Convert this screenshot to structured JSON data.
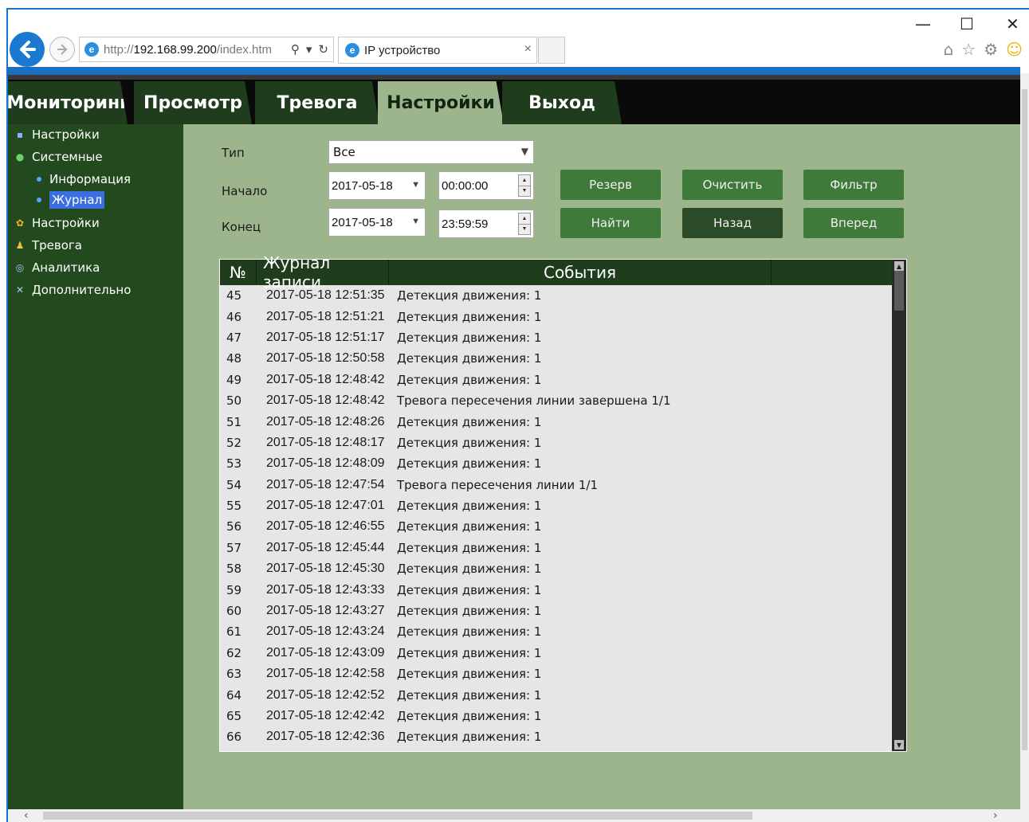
{
  "browser": {
    "url_prefix": "http://",
    "url_host": "192.168.99.200",
    "url_path": "/index.htm",
    "tab_title": "IP устройство",
    "tab_close": "×",
    "search_glyph": "⚲",
    "dropdown_glyph": "▾",
    "refresh_glyph": "↻",
    "minimize": "—",
    "maximize": "☐",
    "close": "✕",
    "tools": [
      "⌂",
      "☆",
      "⚙",
      "☺"
    ]
  },
  "nav": {
    "tabs": [
      {
        "label": "Мониторинг",
        "active": false
      },
      {
        "label": "Просмотр",
        "active": false
      },
      {
        "label": "Тревога",
        "active": false
      },
      {
        "label": "Настройки",
        "active": true
      },
      {
        "label": "Выход",
        "active": false
      }
    ]
  },
  "sidebar": {
    "items": [
      {
        "label": "Настройки",
        "icon": "book-icon"
      },
      {
        "label": "Системные",
        "icon": "info-icon"
      },
      {
        "label": "Настройки",
        "icon": "gear-icon"
      },
      {
        "label": "Тревога",
        "icon": "bell-icon"
      },
      {
        "label": "Аналитика",
        "icon": "analytics-icon"
      },
      {
        "label": "Дополнительно",
        "icon": "tools-icon"
      }
    ],
    "sub_items": [
      {
        "label": "Информация",
        "active": false
      },
      {
        "label": "Журнал",
        "active": true
      }
    ]
  },
  "filter": {
    "type_label": "Тип",
    "type_value": "Все",
    "start_label": "Начало",
    "start_date": "2017-05-18",
    "start_time": "00:00:00",
    "end_label": "Конец",
    "end_date": "2017-05-18",
    "end_time": "23:59:59",
    "buttons": {
      "backup": "Резерв",
      "clear": "Очистить",
      "filter": "Фильтр",
      "find": "Найти",
      "back": "Назад",
      "forward": "Вперед"
    }
  },
  "log_table": {
    "headers": {
      "no": "№",
      "time": "Журнал записи",
      "events": "События"
    },
    "rows": [
      {
        "no": "45",
        "time": "2017-05-18 12:51:35",
        "event": "Детекция движения: 1"
      },
      {
        "no": "46",
        "time": "2017-05-18 12:51:21",
        "event": "Детекция движения: 1"
      },
      {
        "no": "47",
        "time": "2017-05-18 12:51:17",
        "event": "Детекция движения: 1"
      },
      {
        "no": "48",
        "time": "2017-05-18 12:50:58",
        "event": "Детекция движения: 1"
      },
      {
        "no": "49",
        "time": "2017-05-18 12:48:42",
        "event": "Детекция движения: 1"
      },
      {
        "no": "50",
        "time": "2017-05-18 12:48:42",
        "event": "Тревога пересечения линии завершена 1/1"
      },
      {
        "no": "51",
        "time": "2017-05-18 12:48:26",
        "event": "Детекция движения: 1"
      },
      {
        "no": "52",
        "time": "2017-05-18 12:48:17",
        "event": "Детекция движения: 1"
      },
      {
        "no": "53",
        "time": "2017-05-18 12:48:09",
        "event": "Детекция движения: 1"
      },
      {
        "no": "54",
        "time": "2017-05-18 12:47:54",
        "event": "Тревога пересечения линии 1/1"
      },
      {
        "no": "55",
        "time": "2017-05-18 12:47:01",
        "event": "Детекция движения: 1"
      },
      {
        "no": "56",
        "time": "2017-05-18 12:46:55",
        "event": "Детекция движения: 1"
      },
      {
        "no": "57",
        "time": "2017-05-18 12:45:44",
        "event": "Детекция движения: 1"
      },
      {
        "no": "58",
        "time": "2017-05-18 12:45:30",
        "event": "Детекция движения: 1"
      },
      {
        "no": "59",
        "time": "2017-05-18 12:43:33",
        "event": "Детекция движения: 1"
      },
      {
        "no": "60",
        "time": "2017-05-18 12:43:27",
        "event": "Детекция движения: 1"
      },
      {
        "no": "61",
        "time": "2017-05-18 12:43:24",
        "event": "Детекция движения: 1"
      },
      {
        "no": "62",
        "time": "2017-05-18 12:43:09",
        "event": "Детекция движения: 1"
      },
      {
        "no": "63",
        "time": "2017-05-18 12:42:58",
        "event": "Детекция движения: 1"
      },
      {
        "no": "64",
        "time": "2017-05-18 12:42:52",
        "event": "Детекция движения: 1"
      },
      {
        "no": "65",
        "time": "2017-05-18 12:42:42",
        "event": "Детекция движения: 1"
      },
      {
        "no": "66",
        "time": "2017-05-18 12:42:36",
        "event": "Детекция движения: 1"
      }
    ]
  },
  "colors": {
    "nav_bg": "#0a0a0a",
    "tab_bg": "#1f3d1c",
    "tab_active_bg": "#9db58c",
    "sidebar_bg": "#234a1e",
    "content_bg": "#9db58c",
    "button_bg": "#3f7a3a",
    "button_dark_bg": "#2b4a27",
    "table_header_bg": "#1f3d1c",
    "table_bg": "#e6e6e6"
  }
}
